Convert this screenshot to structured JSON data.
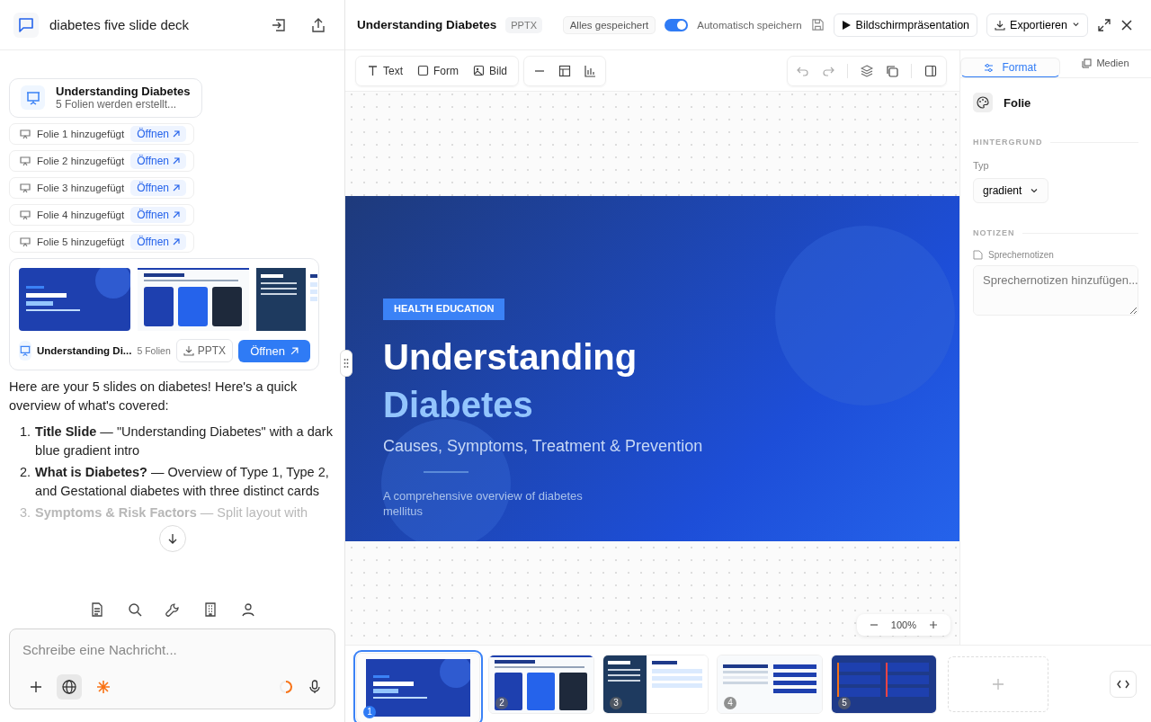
{
  "chat": {
    "title": "diabetes five slide deck",
    "deck_card": {
      "title": "Understanding Diabetes",
      "status": "5 Folien werden erstellt..."
    },
    "slide_events": [
      {
        "label": "Folie 1 hinzugefügt",
        "action": "Öffnen"
      },
      {
        "label": "Folie 2 hinzugefügt",
        "action": "Öffnen"
      },
      {
        "label": "Folie 3 hinzugefügt",
        "action": "Öffnen"
      },
      {
        "label": "Folie 4 hinzugefügt",
        "action": "Öffnen"
      },
      {
        "label": "Folie 5 hinzugefügt",
        "action": "Öffnen"
      }
    ],
    "deck_preview": {
      "slides": [
        {
          "kind": "title"
        },
        {
          "kind": "cards"
        },
        {
          "kind": "split"
        }
      ],
      "name": "Understanding Di...",
      "count": "5 Folien",
      "download": "PPTX",
      "open": "Öffnen"
    },
    "message": {
      "intro": "Here are your 5 slides on diabetes! Here's a quick overview of what's covered:",
      "items": [
        {
          "number": "1.",
          "text": "**Title Slide** — \"Understanding Diabetes\" with a dark blue gradient intro",
          "faded": false
        },
        {
          "number": "2.",
          "text": "**What is Diabetes?** — Overview of Type 1, Type 2, and Gestational diabetes with three distinct cards",
          "faded": false
        },
        {
          "number": "3.",
          "text": "**Symptoms & Risk Factors** — Split layout with",
          "faded": true
        }
      ]
    },
    "input": {
      "placeholder": "Schreibe eine Nachricht...",
      "web_search_on": true
    }
  },
  "editor": {
    "title": "Understanding Diabetes",
    "format": "PPTX",
    "save_status": "Alles gespeichert",
    "autosave": {
      "label": "Automatisch speichern",
      "on": true
    },
    "present": "Bildschirmpräsentation",
    "export": "Exportieren",
    "tools": [
      "Text",
      "Form",
      "Bild"
    ],
    "slide": {
      "badge": "HEALTH EDUCATION",
      "title_line1": "Understanding",
      "title_line2": "Diabetes",
      "subtitle": "Causes, Symptoms, Treatment & Prevention",
      "description": "A comprehensive overview of diabetes mellitus"
    },
    "zoom": "100%",
    "thumbnails": [
      {
        "number": "1",
        "kind": "title",
        "selected": true
      },
      {
        "number": "2",
        "kind": "cards",
        "selected": false
      },
      {
        "number": "3",
        "kind": "split",
        "selected": false
      },
      {
        "number": "4",
        "kind": "table",
        "selected": false
      },
      {
        "number": "5",
        "kind": "dark",
        "selected": false
      }
    ]
  },
  "panel": {
    "tabs": [
      {
        "label": "Format",
        "selected": true
      },
      {
        "label": "Medien",
        "selected": false
      }
    ],
    "heading": "Folie",
    "background_section": "HINTERGRUND",
    "type_label": "Typ",
    "type_value": "gradient",
    "notes_section": "NOTIZEN",
    "notes_label": "Sprechernotizen",
    "notes_placeholder": "Sprechernotizen hinzufügen..."
  }
}
